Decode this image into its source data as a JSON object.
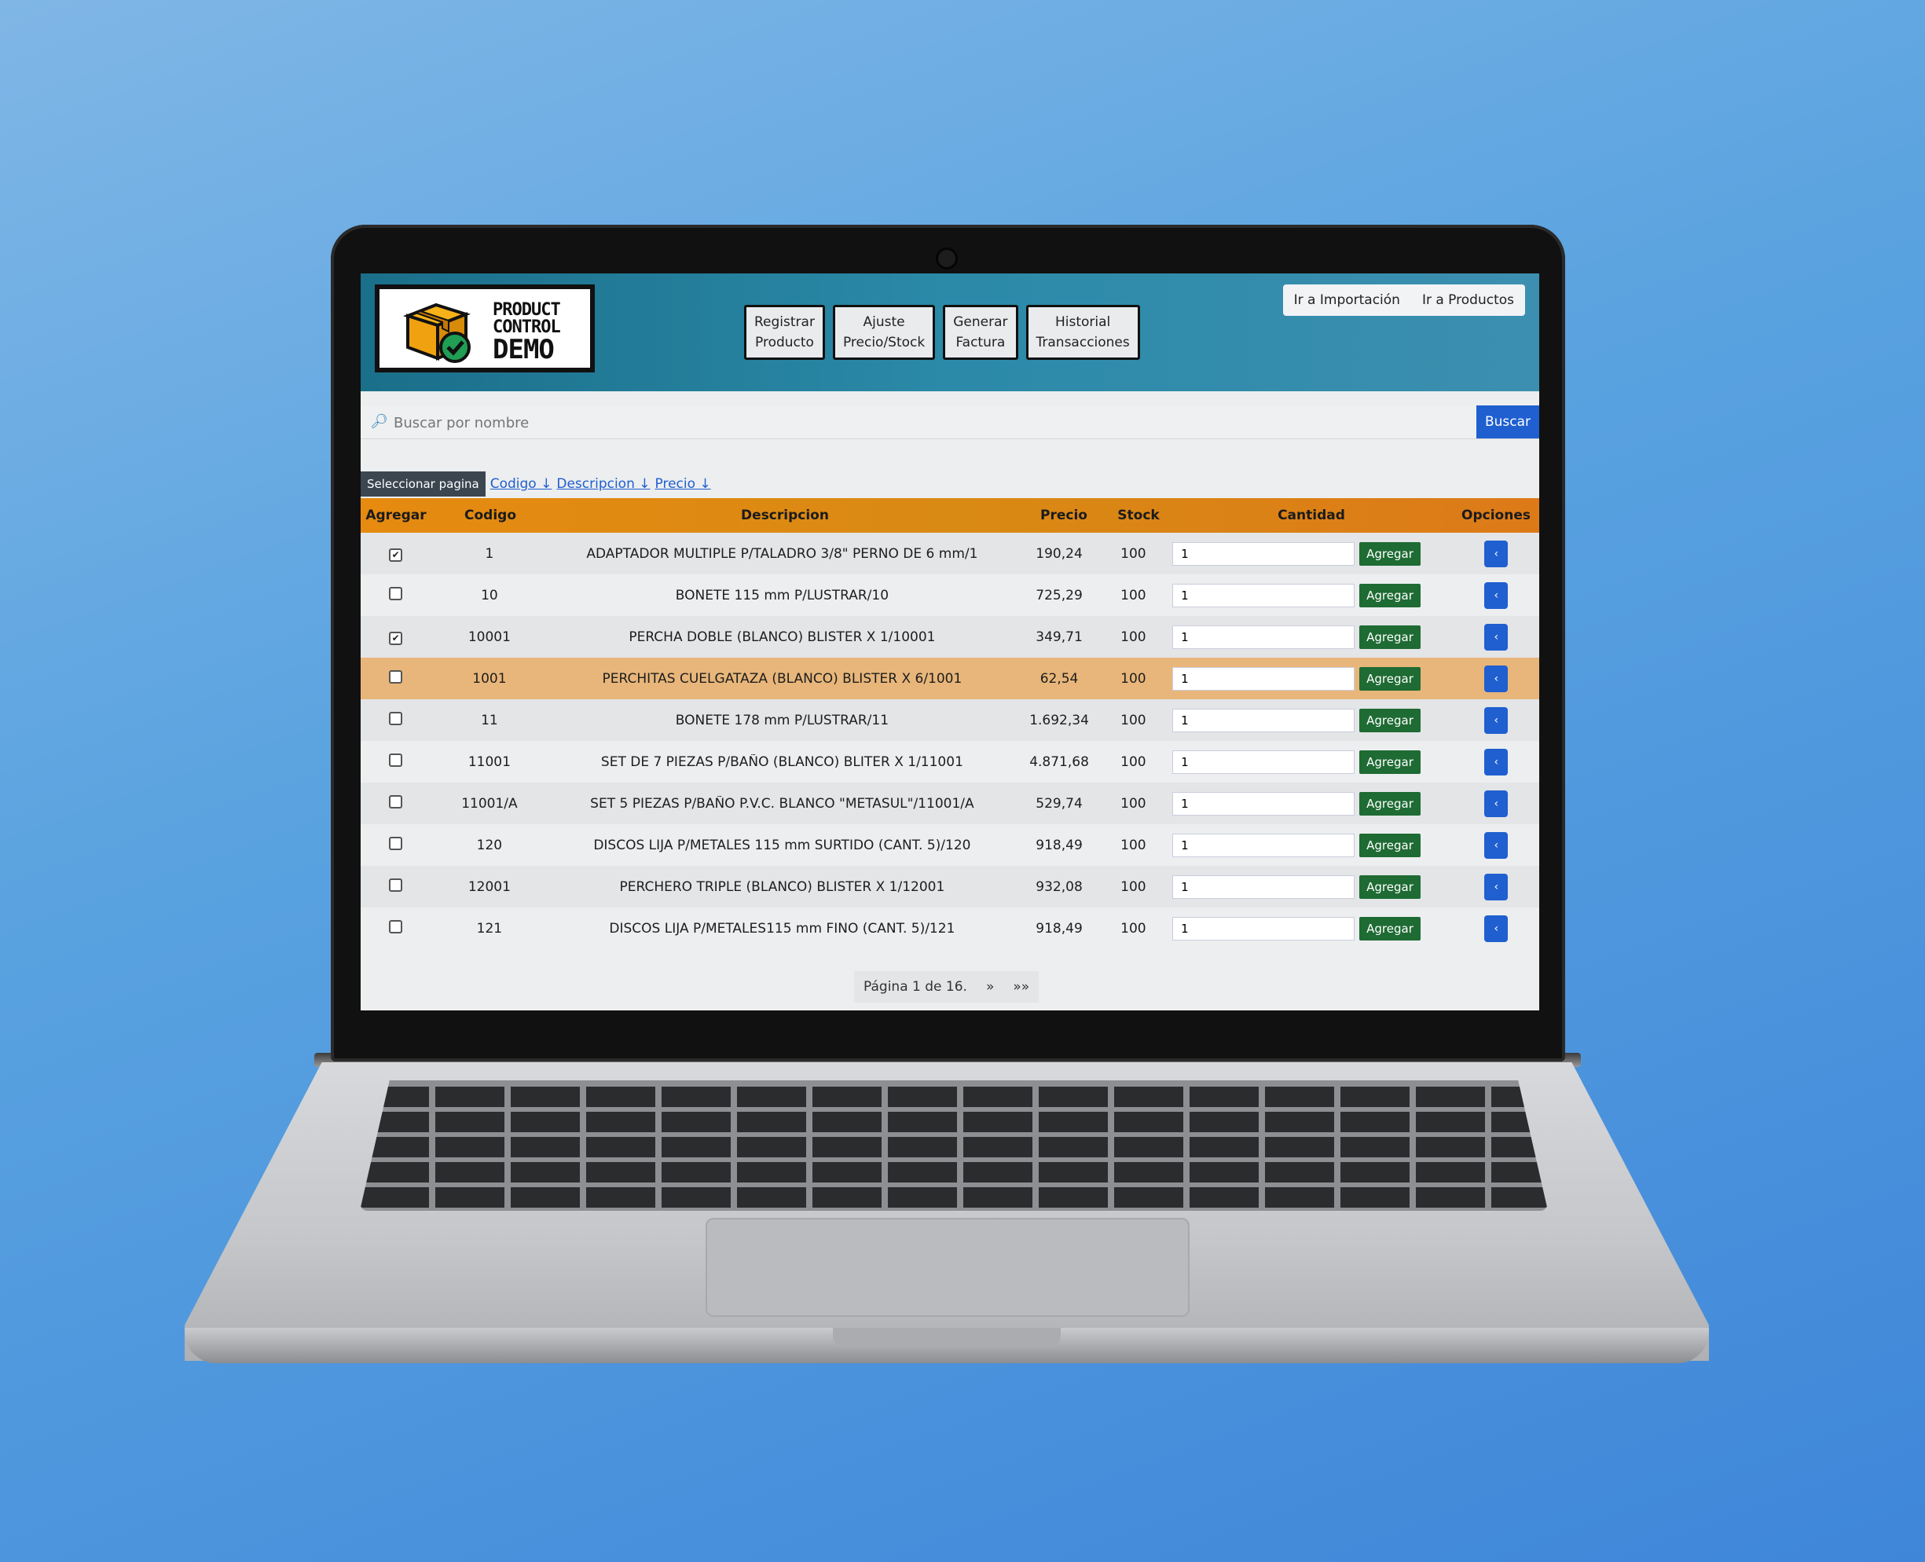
{
  "app": {
    "logo": {
      "line1": "PRODUCT",
      "line2": "CONTROL",
      "line3": "DEMO"
    },
    "nav": [
      {
        "line1": "Registrar",
        "line2": "Producto"
      },
      {
        "line1": "Ajuste",
        "line2": "Precio/Stock"
      },
      {
        "line1": "Generar",
        "line2": "Factura"
      },
      {
        "line1": "Historial",
        "line2": "Transacciones"
      }
    ],
    "top_links": [
      "Ir a Importación",
      "Ir a Productos"
    ],
    "search": {
      "placeholder": "Buscar por nombre",
      "button": "Buscar",
      "icon": "search-icon"
    },
    "sort": {
      "page_select": "Seleccionar pagina",
      "links": [
        "Codigo ↓",
        "Descripcion ↓",
        "Precio ↓"
      ]
    },
    "columns": [
      "Agregar",
      "Codigo",
      "Descripcion",
      "Precio",
      "Stock",
      "Cantidad",
      "Opciones"
    ],
    "rows": [
      {
        "checked": "✔",
        "code": "1",
        "desc": "ADAPTADOR MULTIPLE P/TALADRO 3/8\" PERNO DE 6 mm/1",
        "price": "190,24",
        "stock": "100",
        "qty": "1",
        "btn": "Agregar",
        "opt": "‹"
      },
      {
        "checked": "",
        "code": "10",
        "desc": "BONETE 115 mm P/LUSTRAR/10",
        "price": "725,29",
        "stock": "100",
        "qty": "1",
        "btn": "Agregar",
        "opt": "‹"
      },
      {
        "checked": "✔",
        "code": "10001",
        "desc": "PERCHA DOBLE (BLANCO) BLISTER X 1/10001",
        "price": "349,71",
        "stock": "100",
        "qty": "1",
        "btn": "Agregar",
        "opt": "‹"
      },
      {
        "checked": "",
        "code": "1001",
        "desc": "PERCHITAS CUELGATAZA (BLANCO) BLISTER X 6/1001",
        "price": "62,54",
        "stock": "100",
        "qty": "1",
        "btn": "Agregar",
        "opt": "‹"
      },
      {
        "checked": "",
        "code": "11",
        "desc": "BONETE 178 mm P/LUSTRAR/11",
        "price": "1.692,34",
        "stock": "100",
        "qty": "1",
        "btn": "Agregar",
        "opt": "‹"
      },
      {
        "checked": "",
        "code": "11001",
        "desc": "SET DE 7 PIEZAS P/BAÑO (BLANCO) BLITER X 1/11001",
        "price": "4.871,68",
        "stock": "100",
        "qty": "1",
        "btn": "Agregar",
        "opt": "‹"
      },
      {
        "checked": "",
        "code": "11001/A",
        "desc": "SET 5 PIEZAS P/BAÑO P.V.C. BLANCO \"METASUL\"/11001/A",
        "price": "529,74",
        "stock": "100",
        "qty": "1",
        "btn": "Agregar",
        "opt": "‹"
      },
      {
        "checked": "",
        "code": "120",
        "desc": "DISCOS LIJA P/METALES 115 mm SURTIDO (CANT. 5)/120",
        "price": "918,49",
        "stock": "100",
        "qty": "1",
        "btn": "Agregar",
        "opt": "‹"
      },
      {
        "checked": "",
        "code": "12001",
        "desc": "PERCHERO TRIPLE (BLANCO) BLISTER X 1/12001",
        "price": "932,08",
        "stock": "100",
        "qty": "1",
        "btn": "Agregar",
        "opt": "‹"
      },
      {
        "checked": "",
        "code": "121",
        "desc": "DISCOS LIJA P/METALES115 mm FINO (CANT. 5)/121",
        "price": "918,49",
        "stock": "100",
        "qty": "1",
        "btn": "Agregar",
        "opt": "‹"
      }
    ],
    "pagination": {
      "label": "Página 1 de 16.",
      "next": "»",
      "last": "»»"
    },
    "colors": {
      "header": "#2b8aa8",
      "table_head": "#e08a12",
      "highlight_row": "#e8b67a",
      "primary": "#1f5fd0",
      "success": "#1e6b33"
    }
  }
}
